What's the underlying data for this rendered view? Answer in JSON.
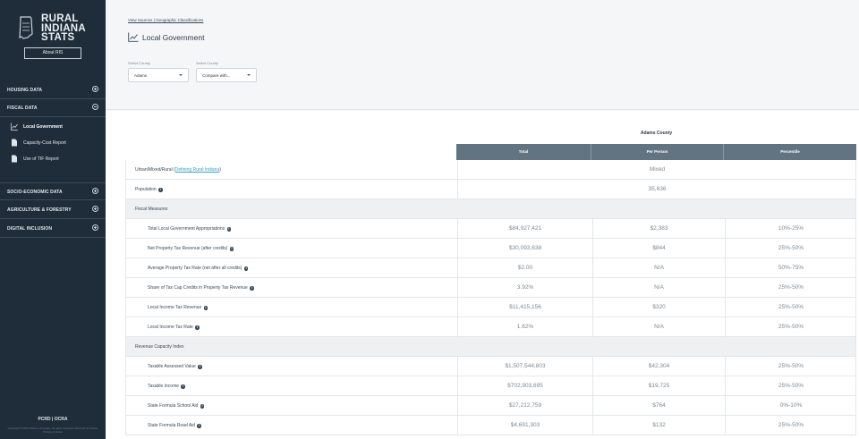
{
  "app": {
    "logo_lines": [
      "RURAL",
      "INDIANA",
      "STATS"
    ],
    "about_label": "About RIS"
  },
  "nav": {
    "housing": "HOUSING DATA",
    "fiscal": "FISCAL DATA",
    "fiscal_items": [
      "Local Government",
      "Capacity-Cost Report",
      "Use of TIF Report"
    ],
    "socio": "SOCIO-ECONOMIC DATA",
    "agri": "AGRICULTURE & FORESTRY",
    "digital": "DIGITAL INCLUSION"
  },
  "footer": {
    "brand": "PCRD | OCRA",
    "copy": "Copyright © 2024 Purdue University. All rights reserved. Site built by Purdue Privacy & Terms"
  },
  "header": {
    "breadcrumb": "View Sources | Geographic Classifications",
    "title": "Local Government",
    "select1_label": "Select County",
    "select1_value": "Adams",
    "select2_label": "Select County",
    "select2_value": "Compare with..."
  },
  "table": {
    "county": "Adams County",
    "columns": [
      "Total",
      "Per Person",
      "Percentile"
    ],
    "urban_label": "Urban/Mixed/Rural (",
    "urban_link": "Defining Rural Indiana",
    "urban_close": ")",
    "urban_value": "Mixed",
    "population_label": "Population",
    "population_value": "35,636",
    "fiscal_section": "Fiscal Measures",
    "revenue_section": "Revenue Capacity Index",
    "fiscal_rows": [
      {
        "label": "Total Local Government Appropriations",
        "total": "$84,927,421",
        "per": "$2,383",
        "pct": "10%-25%"
      },
      {
        "label": "Net Property Tax Revenue (after credits)",
        "total": "$30,093,638",
        "per": "$844",
        "pct": "25%-50%"
      },
      {
        "label": "Average Property Tax Rate (net after all credits)",
        "total": "$2.00",
        "per": "N/A",
        "pct": "50%-75%"
      },
      {
        "label": "Share of Tax Cap Credits in Property Tax Revenue",
        "total": "3.92%",
        "per": "N/A",
        "pct": "25%-50%"
      },
      {
        "label": "Local Income Tax Revenue",
        "total": "$11,415,156",
        "per": "$320",
        "pct": "25%-50%"
      },
      {
        "label": "Local Income Tax Rate",
        "total": "1.62%",
        "per": "N/A",
        "pct": "25%-50%"
      }
    ],
    "revenue_rows": [
      {
        "label": "Taxable Assessed Value",
        "total": "$1,507,544,803",
        "per": "$42,304",
        "pct": "25%-50%"
      },
      {
        "label": "Taxable Income",
        "total": "$702,903,695",
        "per": "$19,725",
        "pct": "25%-50%"
      },
      {
        "label": "State Formula School Aid",
        "total": "$27,212,759",
        "per": "$764",
        "pct": "0%-10%"
      },
      {
        "label": "State Formula Road Aid",
        "total": "$4,691,303",
        "per": "$132",
        "pct": "25%-50%"
      }
    ]
  },
  "colors": {
    "sidebar": "#1f2d3a",
    "header_col": "#627482",
    "link": "#35a3c6"
  }
}
